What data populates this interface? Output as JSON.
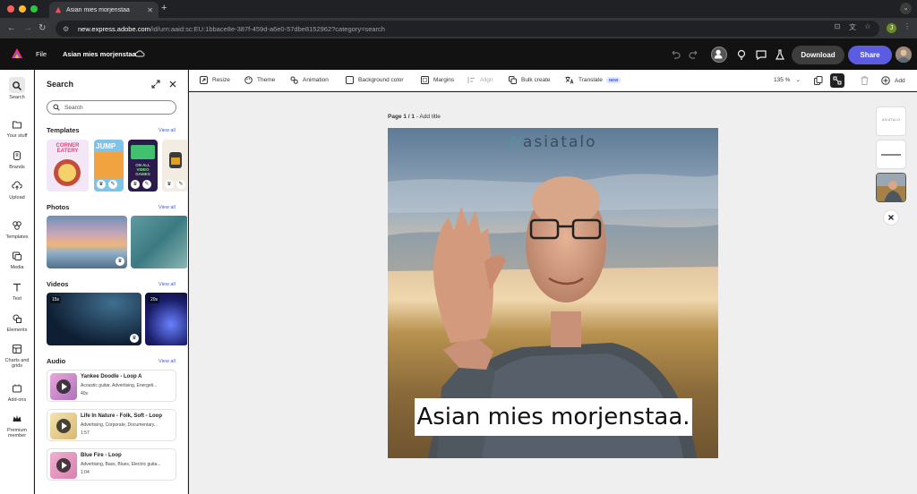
{
  "browser": {
    "tab_title": "Asian mies morjenstaa",
    "url_host": "new.express.adobe.com",
    "url_path": "/id/urn:aaid:sc:EU:1bbace8e-387f-459d-a6e0-57dbe8152962?category=search",
    "profile_initial": "J"
  },
  "header": {
    "file_label": "File",
    "doc_title": "Asian mies morjenstaa",
    "download_label": "Download",
    "share_label": "Share",
    "accent": "#5c5ce0"
  },
  "rail": {
    "items": [
      {
        "label": "Search",
        "icon": "search-icon"
      },
      {
        "label": "Your stuff",
        "icon": "folder-icon"
      },
      {
        "label": "Brands",
        "icon": "brand-icon"
      },
      {
        "label": "Upload",
        "icon": "upload-icon"
      },
      {
        "label": "Templates",
        "icon": "templates-icon"
      },
      {
        "label": "Media",
        "icon": "media-icon"
      },
      {
        "label": "Text",
        "icon": "text-icon"
      },
      {
        "label": "Elements",
        "icon": "elements-icon"
      },
      {
        "label": "Charts and",
        "label2": "grids",
        "icon": "charts-icon"
      },
      {
        "label": "Add-ons",
        "icon": "addons-icon"
      },
      {
        "label": "Premium",
        "label2": "member",
        "icon": "crown-icon"
      }
    ]
  },
  "panel": {
    "title": "Search",
    "search_placeholder": "Search",
    "view_all": "View all",
    "templates_title": "Templates",
    "photos_title": "Photos",
    "videos_title": "Videos",
    "audio_title": "Audio",
    "templates": [
      {
        "text": "CORNER EATERY"
      },
      {
        "text": "JUMP"
      },
      {
        "text": "ON ALL VIDEO GAMES"
      },
      {
        "text": ""
      }
    ],
    "video_durations": [
      "15s",
      "20s"
    ],
    "audio": [
      {
        "title": "Yankee Doodle - Loop A",
        "tags": "Acoustic guitar, Advertising, Energeti...",
        "length": "40s"
      },
      {
        "title": "Life In Nature - Folk, Soft - Loop",
        "tags": "Advertising, Corporate, Documentary...",
        "length": "1:57"
      },
      {
        "title": "Blue Fire - Loop",
        "tags": "Advertising, Bass, Blues, Electric guita...",
        "length": "1:04"
      }
    ]
  },
  "toolbar": {
    "resize": "Resize",
    "theme": "Theme",
    "animation": "Animation",
    "background_color": "Background color",
    "margins": "Margins",
    "align": "Align",
    "bulk_create": "Bulk create",
    "translate": "Translate",
    "new_badge": "NEW",
    "zoom": "135 %",
    "add": "Add"
  },
  "canvas": {
    "page_label": "Page 1 / 1",
    "add_title": " - Add title",
    "brand_slashes": "//",
    "brand_name": "asiatalo",
    "caption": "Asian mies morjenstaa.",
    "thumb_brand": "ASIATALO"
  }
}
